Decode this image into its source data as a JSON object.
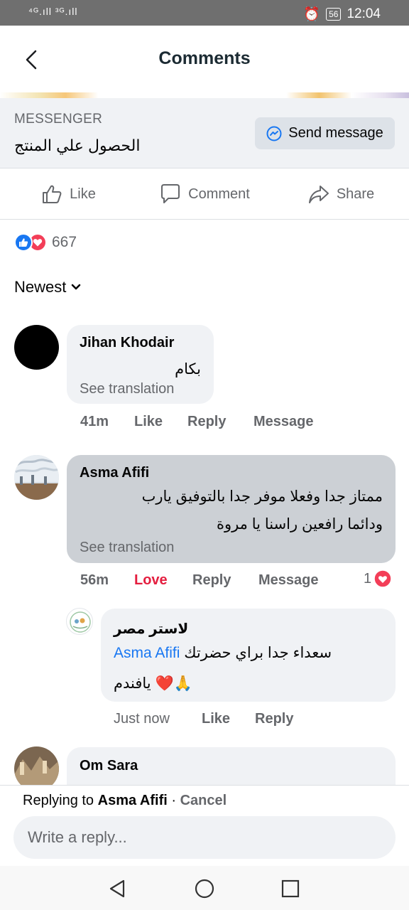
{
  "status": {
    "signal": "⁴ᴳ.ıll ³ᴳ.ıll",
    "battery": "56",
    "time": "12:04"
  },
  "header": {
    "title": "Comments"
  },
  "post_card": {
    "source": "MESSENGER",
    "caption": "الحصول علي المنتج",
    "send_label": "Send message"
  },
  "actions": {
    "like": "Like",
    "comment": "Comment",
    "share": "Share"
  },
  "reactions": {
    "count": "667"
  },
  "sort": {
    "label": "Newest"
  },
  "comments": [
    {
      "author": "Jihan Khodair",
      "text": "بكام",
      "translate": "See translation",
      "time": "41m",
      "like": "Like",
      "reply": "Reply",
      "message": "Message"
    },
    {
      "author": "Asma Afifi",
      "text_line1": "ممتاز جدا وفعلا موفر جدا بالتوفيق يارب",
      "text_line2": "ودائما رافعين راسنا يا مروة",
      "translate": "See translation",
      "time": "56m",
      "like": "Love",
      "reply": "Reply",
      "message": "Message",
      "reaction_count": "1"
    },
    {
      "author": "لاستر مصر",
      "mention": "Asma Afifi",
      "text_line1": "سعداء جدا براي حضرتك",
      "text_line2": "يافندم",
      "emoji": "❤️🙏",
      "time": "Just now",
      "like": "Like",
      "reply": "Reply"
    },
    {
      "author": "Om Sara"
    }
  ],
  "reply_bar": {
    "prefix": "Replying to",
    "target": "Asma Afifi",
    "separator": " · ",
    "cancel": "Cancel",
    "placeholder": "Write a reply..."
  },
  "colors": {
    "accent": "#1877f2",
    "love": "#e41e3f",
    "bubble": "#f0f2f5",
    "bubble_selected": "#ccd0d5"
  }
}
